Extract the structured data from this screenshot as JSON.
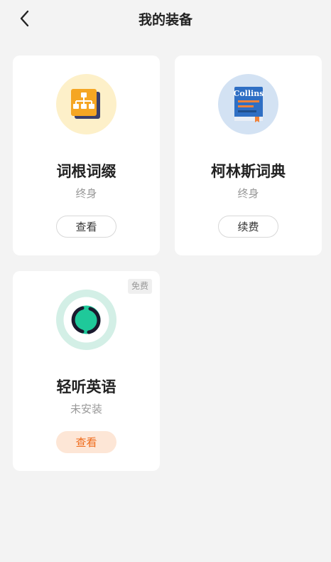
{
  "header": {
    "title": "我的装备"
  },
  "cards": [
    {
      "name": "词根词缀",
      "status": "终身",
      "button": "查看"
    },
    {
      "name": "柯林斯词典",
      "status": "终身",
      "button": "续费",
      "logo_text": "Collins"
    },
    {
      "name": "轻听英语",
      "status": "未安装",
      "button": "查看",
      "badge": "免费"
    }
  ],
  "colors": {
    "background": "#f3f3f3",
    "accent_orange": "#ef6a19",
    "accent_orange_bg": "#fde6d6",
    "collins_blue": "#2f6fc4",
    "teal": "#1fc99a"
  }
}
